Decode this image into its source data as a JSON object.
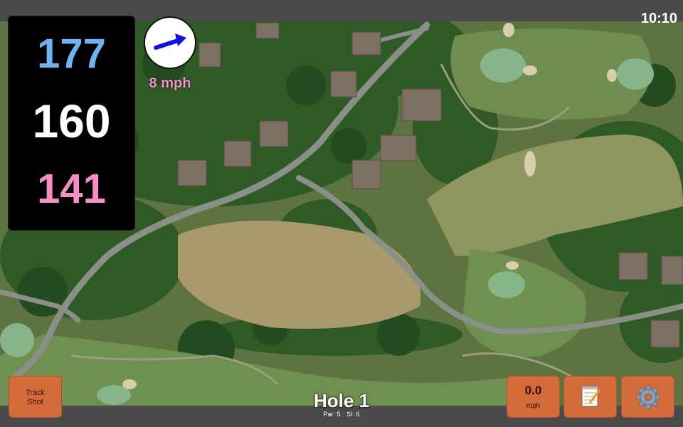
{
  "status": {
    "clock": "10:10"
  },
  "yardage": {
    "back": "177",
    "center": "160",
    "front": "141"
  },
  "wind": {
    "speed_label": "8 mph",
    "arrow_icon": "arrow-right-icon",
    "arrow_color": "#1111dd"
  },
  "hole": {
    "title": "Hole 1",
    "par_label": "Par: 5",
    "si_label": "SI: 6"
  },
  "buttons": {
    "track_shot_line1": "Track",
    "track_shot_line2": "Shot",
    "wind_value": "0.0",
    "wind_unit": "mph",
    "notes_icon": "notepad-icon",
    "settings_icon": "gear-icon"
  },
  "colors": {
    "back_yardage": "#6fb3f5",
    "center_yardage": "#ffffff",
    "front_yardage": "#f58ec5",
    "button": "#d46b3b"
  }
}
